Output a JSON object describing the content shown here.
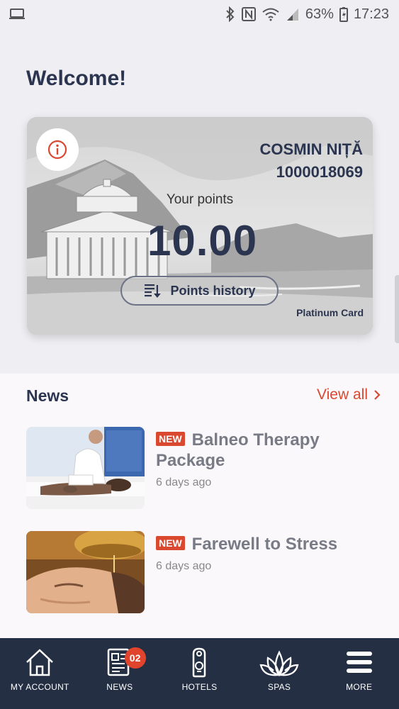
{
  "status_bar": {
    "battery": "63%",
    "time": "17:23",
    "icons": [
      "laptop-icon",
      "bluetooth-icon",
      "nfc-icon",
      "wifi-icon",
      "signal-icon",
      "battery-icon"
    ]
  },
  "welcome": "Welcome!",
  "card": {
    "holder_name": "COSMIN NIȚĂ",
    "card_number": "1000018069",
    "points_label": "Your points",
    "points_value": "10.00",
    "history_label": "Points history",
    "tier": "Platinum Card",
    "info_icon": "info-icon"
  },
  "news": {
    "title": "News",
    "view_all": "View all",
    "items": [
      {
        "badge": "NEW",
        "headline": "Balneo Therapy Package",
        "age": "6 days ago"
      },
      {
        "badge": "NEW",
        "headline": "Farewell to Stress",
        "age": "6 days ago"
      }
    ]
  },
  "nav": {
    "items": [
      {
        "label": "MY ACCOUNT",
        "icon": "house-icon"
      },
      {
        "label": "NEWS",
        "icon": "newspaper-icon",
        "badge": "02"
      },
      {
        "label": "HOTELS",
        "icon": "door-hanger-icon"
      },
      {
        "label": "SPAS",
        "icon": "lotus-icon"
      },
      {
        "label": "MORE",
        "icon": "menu-icon"
      }
    ]
  },
  "colors": {
    "accent": "#d9482f",
    "navy": "#2b3550",
    "nav_bg": "#252f44"
  }
}
